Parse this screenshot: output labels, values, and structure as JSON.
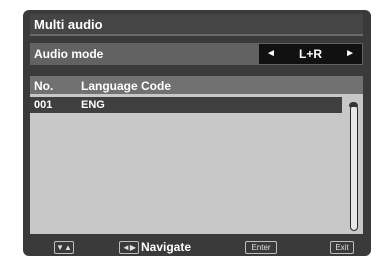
{
  "title": "Multi audio",
  "audio_mode": {
    "label": "Audio mode",
    "value": "L+R",
    "left_arrow": "◄",
    "right_arrow": "►"
  },
  "list": {
    "headers": {
      "no": "No.",
      "language_code": "Language Code"
    },
    "rows": [
      {
        "no": "001",
        "language_code": "ENG"
      }
    ]
  },
  "footer": {
    "up_down_key": "▼▲",
    "left_right_key": "◄▶",
    "navigate_label": "Navigate",
    "enter_key": "Enter",
    "exit_key": "Exit"
  }
}
